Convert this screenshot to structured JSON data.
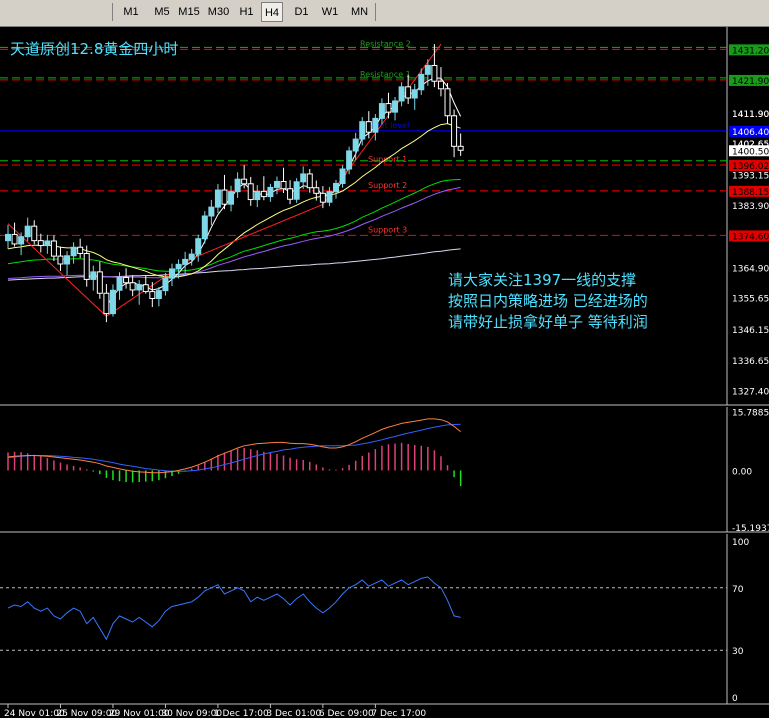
{
  "toolbar": {
    "timeframes": [
      "M1",
      "M5",
      "M15",
      "M30",
      "H1",
      "H4",
      "D1",
      "W1",
      "MN"
    ],
    "active": "H4"
  },
  "colors": {
    "background": "#000000",
    "grid": "#c0c0c0",
    "bull_candle": "#7fd8e8",
    "bear_candle": "#ffffff",
    "resistance": "#ff0000",
    "resistance_label": "#1e9e1e",
    "support_label": "#ff3030",
    "pivot": "#0000ff",
    "ma_yellow": "#ffff80",
    "ma_white": "#ffffff",
    "ma_violet": "#9a5cff",
    "ma_green": "#00e000",
    "ma_light": "#d8d8f0",
    "annotation": "#4ee0ff",
    "macd_pos": "#e0407a",
    "macd_neg": "#20e020",
    "macd_main": "#ff8040",
    "macd_signal": "#3060ff",
    "rsi": "#3a78ff"
  },
  "chart_data": [
    {
      "type": "candlestick",
      "title": "天道原创12.8黄金四小时",
      "ylim": [
        1323.0,
        1438.0
      ],
      "y_ticks": [
        "1431.20",
        "1421.90",
        "1411.90",
        "1402.65",
        "1400.50",
        "1393.15",
        "1383.90",
        "1374.60",
        "1364.90",
        "1355.65",
        "1346.15",
        "1336.65",
        "1327.40"
      ],
      "price_tags": [
        {
          "label": "1431.20",
          "value": 1431.2,
          "style": "level-green"
        },
        {
          "label": "1421.90",
          "value": 1421.9,
          "style": "level-green"
        },
        {
          "label": "1411.90",
          "value": 1411.9,
          "style": "plain"
        },
        {
          "label": "1406.40",
          "value": 1406.4,
          "style": "pivot"
        },
        {
          "label": "1402.65",
          "value": 1402.65,
          "style": "plain"
        },
        {
          "label": "1400.50",
          "value": 1400.5,
          "style": "current"
        },
        {
          "label": "1396.02",
          "value": 1396.02,
          "style": "level-red"
        },
        {
          "label": "1388.15",
          "value": 1388.15,
          "style": "level-red"
        },
        {
          "label": "1374.60",
          "value": 1374.6,
          "style": "level-red"
        }
      ],
      "levels": [
        {
          "name": "Resistance 2",
          "value": 1431.2,
          "kind": "resistance"
        },
        {
          "name": "Resistance 1",
          "value": 1421.9,
          "kind": "resistance"
        },
        {
          "name": "Pivot level",
          "value": 1406.4,
          "kind": "pivot"
        },
        {
          "name": "Support 1",
          "value": 1396.02,
          "kind": "support"
        },
        {
          "name": "Support 2",
          "value": 1388.15,
          "kind": "support"
        },
        {
          "name": "Support 3",
          "value": 1374.6,
          "kind": "support"
        }
      ],
      "candles": [
        [
          1373.0,
          1377.8,
          1370.5,
          1374.9
        ],
        [
          1374.9,
          1378.5,
          1371.2,
          1372.0
        ],
        [
          1372.0,
          1375.5,
          1368.6,
          1374.2
        ],
        [
          1374.2,
          1380.0,
          1372.8,
          1377.4
        ],
        [
          1377.4,
          1379.2,
          1371.9,
          1373.0
        ],
        [
          1373.0,
          1375.1,
          1369.4,
          1371.5
        ],
        [
          1371.5,
          1374.8,
          1369.0,
          1372.9
        ],
        [
          1372.9,
          1374.6,
          1366.8,
          1368.3
        ],
        [
          1368.3,
          1371.2,
          1363.8,
          1365.9
        ],
        [
          1365.9,
          1369.8,
          1362.5,
          1368.4
        ],
        [
          1368.4,
          1372.5,
          1366.0,
          1371.0
        ],
        [
          1371.0,
          1373.6,
          1367.7,
          1369.1
        ],
        [
          1369.1,
          1371.5,
          1359.0,
          1361.2
        ],
        [
          1361.2,
          1365.4,
          1357.8,
          1363.5
        ],
        [
          1363.5,
          1366.7,
          1355.3,
          1357.0
        ],
        [
          1357.0,
          1359.8,
          1348.2,
          1350.8
        ],
        [
          1350.8,
          1359.7,
          1349.9,
          1357.9
        ],
        [
          1357.9,
          1363.4,
          1355.0,
          1361.8
        ],
        [
          1361.8,
          1364.6,
          1358.4,
          1360.2
        ],
        [
          1360.2,
          1362.5,
          1356.1,
          1358.0
        ],
        [
          1358.0,
          1361.0,
          1353.5,
          1359.6
        ],
        [
          1359.6,
          1362.3,
          1356.9,
          1357.5
        ],
        [
          1357.5,
          1360.4,
          1352.8,
          1355.4
        ],
        [
          1355.4,
          1358.9,
          1353.0,
          1357.8
        ],
        [
          1357.8,
          1363.2,
          1356.3,
          1361.6
        ],
        [
          1361.6,
          1366.0,
          1359.2,
          1364.4
        ],
        [
          1364.4,
          1367.3,
          1361.5,
          1365.8
        ],
        [
          1365.8,
          1369.6,
          1363.1,
          1367.3
        ],
        [
          1367.3,
          1370.5,
          1365.4,
          1368.9
        ],
        [
          1368.9,
          1374.8,
          1366.6,
          1373.6
        ],
        [
          1373.6,
          1382.0,
          1372.1,
          1380.5
        ],
        [
          1380.5,
          1385.4,
          1377.7,
          1383.2
        ],
        [
          1383.2,
          1390.2,
          1381.4,
          1388.4
        ],
        [
          1388.4,
          1393.0,
          1382.6,
          1384.1
        ],
        [
          1384.1,
          1389.7,
          1381.9,
          1387.9
        ],
        [
          1387.9,
          1393.8,
          1386.0,
          1391.7
        ],
        [
          1391.7,
          1396.0,
          1388.9,
          1390.3
        ],
        [
          1390.3,
          1392.4,
          1383.6,
          1385.5
        ],
        [
          1385.5,
          1389.9,
          1383.2,
          1388.0
        ],
        [
          1388.0,
          1392.6,
          1385.3,
          1386.4
        ],
        [
          1386.4,
          1390.3,
          1384.8,
          1389.2
        ],
        [
          1389.2,
          1392.5,
          1387.1,
          1391.0
        ],
        [
          1391.0,
          1395.2,
          1387.5,
          1388.8
        ],
        [
          1388.8,
          1391.4,
          1384.1,
          1385.6
        ],
        [
          1385.6,
          1392.0,
          1384.5,
          1390.9
        ],
        [
          1390.9,
          1395.6,
          1388.7,
          1393.3
        ],
        [
          1393.3,
          1394.8,
          1387.6,
          1389.1
        ],
        [
          1389.1,
          1391.3,
          1385.2,
          1387.4
        ],
        [
          1387.4,
          1389.6,
          1382.9,
          1384.7
        ],
        [
          1384.7,
          1389.3,
          1383.5,
          1387.9
        ],
        [
          1387.9,
          1391.5,
          1385.8,
          1390.4
        ],
        [
          1390.4,
          1395.9,
          1389.1,
          1394.8
        ],
        [
          1394.8,
          1401.6,
          1393.2,
          1400.3
        ],
        [
          1400.3,
          1405.8,
          1397.5,
          1403.9
        ],
        [
          1403.9,
          1410.6,
          1402.0,
          1409.2
        ],
        [
          1409.2,
          1412.4,
          1404.1,
          1406.0
        ],
        [
          1406.0,
          1411.5,
          1403.5,
          1410.2
        ],
        [
          1410.2,
          1416.3,
          1408.4,
          1414.7
        ],
        [
          1414.7,
          1418.0,
          1410.2,
          1412.1
        ],
        [
          1412.1,
          1416.7,
          1409.6,
          1415.5
        ],
        [
          1415.5,
          1421.2,
          1413.9,
          1419.8
        ],
        [
          1419.8,
          1423.5,
          1414.6,
          1416.4
        ],
        [
          1416.4,
          1420.7,
          1412.8,
          1418.9
        ],
        [
          1418.9,
          1425.4,
          1417.3,
          1423.6
        ],
        [
          1423.6,
          1428.2,
          1420.1,
          1426.3
        ],
        [
          1426.3,
          1432.8,
          1419.7,
          1421.5
        ],
        [
          1421.5,
          1425.8,
          1416.9,
          1419.2
        ],
        [
          1419.2,
          1421.0,
          1408.5,
          1411.0
        ],
        [
          1411.0,
          1412.9,
          1398.4,
          1401.7
        ],
        [
          1401.7,
          1405.6,
          1398.8,
          1400.5
        ]
      ],
      "ma_yellow": [
        1370.5,
        1370.9,
        1371.1,
        1371.5,
        1371.6,
        1371.6,
        1371.6,
        1371.4,
        1371.0,
        1370.8,
        1370.8,
        1370.6,
        1369.9,
        1369.4,
        1368.5,
        1367.2,
        1366.5,
        1366.1,
        1365.5,
        1364.9,
        1364.3,
        1363.7,
        1362.9,
        1362.3,
        1362.0,
        1361.9,
        1362.0,
        1362.4,
        1362.9,
        1363.8,
        1365.2,
        1366.8,
        1368.8,
        1370.4,
        1372.0,
        1373.8,
        1375.4,
        1376.6,
        1377.9,
        1379.0,
        1380.1,
        1381.2,
        1382.2,
        1382.9,
        1383.8,
        1384.8,
        1385.6,
        1386.2,
        1386.5,
        1386.8,
        1387.3,
        1388.1,
        1389.4,
        1390.8,
        1392.5,
        1393.9,
        1395.3,
        1396.9,
        1398.2,
        1399.5,
        1401.0,
        1402.2,
        1403.4,
        1404.8,
        1406.3,
        1407.4,
        1408.3,
        1408.6,
        1407.9,
        1407.2
      ],
      "ma_white": [
        null,
        null,
        null,
        null,
        null,
        null,
        null,
        null,
        null,
        null,
        null,
        null,
        null,
        null,
        null,
        1353.0,
        1356.0,
        1358.6,
        1360.0,
        1360.2,
        1359.6,
        1359.0,
        1358.0,
        1358.4,
        1359.6,
        1361.3,
        1363.1,
        1365.4,
        1366.6,
        1369.0,
        1372.8,
        1377.1,
        1380.9,
        1383.5,
        1386.0,
        1388.9,
        1390.4,
        1388.5,
        1387.5,
        1386.8,
        1387.4,
        1388.6,
        1388.9,
        1387.8,
        1388.4,
        1389.7,
        1389.4,
        1388.8,
        1386.9,
        1386.9,
        1388.3,
        1391.3,
        1395.5,
        1399.4,
        1404.2,
        1405.7,
        1407.8,
        1411.1,
        1412.5,
        1413.9,
        1416.5,
        1417.5,
        1418.2,
        1420.1,
        1421.6,
        1422.5,
        1422.4,
        1419.8,
        1414.9,
        1410.8
      ],
      "ma_violet": [
        1361.5,
        1361.6,
        1361.7,
        1361.9,
        1362.0,
        1362.1,
        1362.2,
        1362.2,
        1362.2,
        1362.3,
        1362.4,
        1362.5,
        1362.4,
        1362.4,
        1362.3,
        1362.0,
        1361.9,
        1361.9,
        1361.9,
        1361.9,
        1361.9,
        1361.8,
        1361.7,
        1361.7,
        1361.8,
        1362.0,
        1362.3,
        1362.6,
        1363.0,
        1363.4,
        1364.0,
        1364.7,
        1365.5,
        1366.1,
        1366.7,
        1367.4,
        1368.1,
        1368.6,
        1369.2,
        1369.7,
        1370.3,
        1370.9,
        1371.4,
        1371.8,
        1372.3,
        1372.8,
        1373.3,
        1373.7,
        1374.0,
        1374.4,
        1374.9,
        1375.5,
        1376.2,
        1377.0,
        1377.9,
        1378.7,
        1379.5,
        1380.4,
        1381.2,
        1382.0,
        1382.9,
        1383.7,
        1384.5,
        1385.4,
        1386.3,
        1387.1,
        1387.8,
        1388.4,
        1388.8,
        1389.2
      ],
      "ma_green": [
        1366.0,
        1366.3,
        1366.6,
        1366.9,
        1367.1,
        1367.2,
        1367.4,
        1367.4,
        1367.4,
        1367.4,
        1367.5,
        1367.5,
        1367.3,
        1367.1,
        1366.8,
        1366.2,
        1365.8,
        1365.6,
        1365.3,
        1365.0,
        1364.8,
        1364.5,
        1364.1,
        1363.8,
        1363.7,
        1363.7,
        1363.8,
        1363.9,
        1364.1,
        1364.5,
        1365.1,
        1365.8,
        1366.7,
        1367.4,
        1368.1,
        1369.0,
        1369.8,
        1370.3,
        1370.9,
        1371.5,
        1372.1,
        1372.7,
        1373.3,
        1373.7,
        1374.2,
        1374.8,
        1375.3,
        1375.7,
        1375.9,
        1376.2,
        1376.7,
        1377.3,
        1378.1,
        1379.0,
        1380.1,
        1381.0,
        1381.9,
        1382.9,
        1383.8,
        1384.7,
        1385.7,
        1386.6,
        1387.5,
        1388.5,
        1389.5,
        1390.3,
        1391.0,
        1391.4,
        1391.5,
        1391.6
      ],
      "ma_light": [
        1361.0,
        1361.1,
        1361.2,
        1361.3,
        1361.4,
        1361.5,
        1361.6,
        1361.6,
        1361.7,
        1361.8,
        1361.9,
        1362.0,
        1362.0,
        1362.0,
        1362.0,
        1362.0,
        1362.0,
        1362.1,
        1362.2,
        1362.3,
        1362.3,
        1362.4,
        1362.4,
        1362.5,
        1362.6,
        1362.7,
        1362.8,
        1362.9,
        1363.0,
        1363.2,
        1363.3,
        1363.5,
        1363.7,
        1363.8,
        1363.9,
        1364.1,
        1364.2,
        1364.4,
        1364.5,
        1364.6,
        1364.8,
        1364.9,
        1365.1,
        1365.2,
        1365.4,
        1365.5,
        1365.6,
        1365.8,
        1365.9,
        1366.0,
        1366.2,
        1366.3,
        1366.5,
        1366.7,
        1366.9,
        1367.1,
        1367.3,
        1367.5,
        1367.8,
        1368.0,
        1368.3,
        1368.5,
        1368.8,
        1369.0,
        1369.3,
        1369.6,
        1369.8,
        1370.1,
        1370.3,
        1370.5
      ],
      "annotations": [
        "请大家关注1397一线的支撑",
        "按照日内策略进场    已经进场的",
        "请带好止损拿好单子   等待利润"
      ]
    },
    {
      "type": "bar",
      "name": "MACD",
      "ylim": [
        -16.5,
        17.0
      ],
      "y_ticks": [
        "15.7885",
        "0.00",
        "-15.1937"
      ],
      "histogram": [
        4.8,
        5.0,
        4.9,
        4.6,
        4.2,
        3.8,
        3.3,
        2.7,
        2.1,
        1.6,
        1.2,
        0.8,
        0.3,
        -0.3,
        -1.0,
        -2.0,
        -2.6,
        -2.9,
        -3.1,
        -3.2,
        -3.1,
        -3.0,
        -2.9,
        -2.6,
        -2.1,
        -1.5,
        -0.9,
        -0.2,
        0.5,
        1.3,
        2.2,
        3.2,
        4.2,
        4.8,
        5.3,
        5.8,
        6.0,
        5.7,
        5.4,
        5.0,
        4.7,
        4.4,
        4.0,
        3.4,
        3.0,
        2.8,
        2.3,
        1.6,
        0.8,
        0.3,
        0.2,
        0.6,
        1.5,
        2.6,
        3.9,
        4.8,
        5.7,
        6.6,
        7.0,
        7.2,
        7.4,
        7.1,
        6.8,
        6.6,
        6.3,
        5.4,
        3.8,
        1.4,
        -1.8,
        -4.2
      ],
      "main": [
        3.6,
        3.8,
        3.9,
        4.0,
        4.0,
        3.9,
        3.8,
        3.6,
        3.4,
        3.2,
        3.0,
        2.8,
        2.5,
        2.2,
        1.8,
        1.2,
        0.8,
        0.4,
        0.1,
        -0.2,
        -0.4,
        -0.5,
        -0.6,
        -0.6,
        -0.5,
        -0.3,
        0.0,
        0.4,
        0.9,
        1.5,
        2.2,
        3.0,
        3.9,
        4.6,
        5.3,
        6.0,
        6.6,
        6.9,
        7.2,
        7.3,
        7.4,
        7.5,
        7.5,
        7.3,
        7.2,
        7.2,
        7.0,
        6.7,
        6.3,
        6.0,
        6.0,
        6.3,
        6.9,
        7.7,
        8.6,
        9.4,
        10.2,
        11.0,
        11.6,
        12.1,
        12.6,
        12.9,
        13.2,
        13.5,
        13.8,
        13.8,
        13.6,
        13.0,
        11.8,
        10.4
      ],
      "signal": [
        3.4,
        3.6,
        3.8,
        3.9,
        4.0,
        4.0,
        4.0,
        3.9,
        3.8,
        3.7,
        3.5,
        3.4,
        3.2,
        3.0,
        2.7,
        2.4,
        2.1,
        1.7,
        1.4,
        1.1,
        0.8,
        0.5,
        0.3,
        0.1,
        -0.1,
        -0.2,
        -0.2,
        -0.2,
        -0.1,
        0.1,
        0.4,
        0.7,
        1.1,
        1.6,
        2.0,
        2.5,
        3.0,
        3.5,
        4.0,
        4.4,
        4.8,
        5.1,
        5.5,
        5.7,
        6.0,
        6.2,
        6.4,
        6.5,
        6.6,
        6.6,
        6.6,
        6.6,
        6.7,
        6.8,
        7.1,
        7.4,
        7.8,
        8.2,
        8.7,
        9.1,
        9.6,
        10.0,
        10.4,
        10.8,
        11.2,
        11.6,
        11.9,
        12.2,
        12.3,
        12.4
      ]
    },
    {
      "type": "line",
      "name": "RSI",
      "ylim": [
        0,
        100
      ],
      "y_ticks": [
        "100",
        "70",
        "30",
        "0"
      ],
      "levels": [
        70,
        30
      ],
      "values": [
        57,
        59,
        58,
        61,
        57,
        55,
        57,
        52,
        50,
        54,
        57,
        55,
        47,
        51,
        44,
        37,
        47,
        52,
        50,
        48,
        51,
        48,
        45,
        49,
        55,
        58,
        59,
        60,
        61,
        64,
        68,
        70,
        72,
        66,
        68,
        70,
        68,
        61,
        64,
        62,
        64,
        66,
        63,
        59,
        63,
        66,
        61,
        57,
        54,
        57,
        61,
        66,
        70,
        72,
        75,
        71,
        73,
        75,
        71,
        73,
        75,
        72,
        74,
        76,
        77,
        73,
        70,
        62,
        52,
        51
      ]
    }
  ],
  "x_axis_labels": [
    {
      "label": "24 Nov 01:00",
      "index": 0
    },
    {
      "label": "25 Nov 09:00",
      "index": 8
    },
    {
      "label": "29 Nov 01:00",
      "index": 16
    },
    {
      "label": "30 Nov 09:00",
      "index": 24
    },
    {
      "label": "1 Dec 17:00",
      "index": 32
    },
    {
      "label": "3 Dec 01:00",
      "index": 40
    },
    {
      "label": "6 Dec 09:00",
      "index": 48
    },
    {
      "label": "7 Dec 17:00",
      "index": 56
    }
  ]
}
